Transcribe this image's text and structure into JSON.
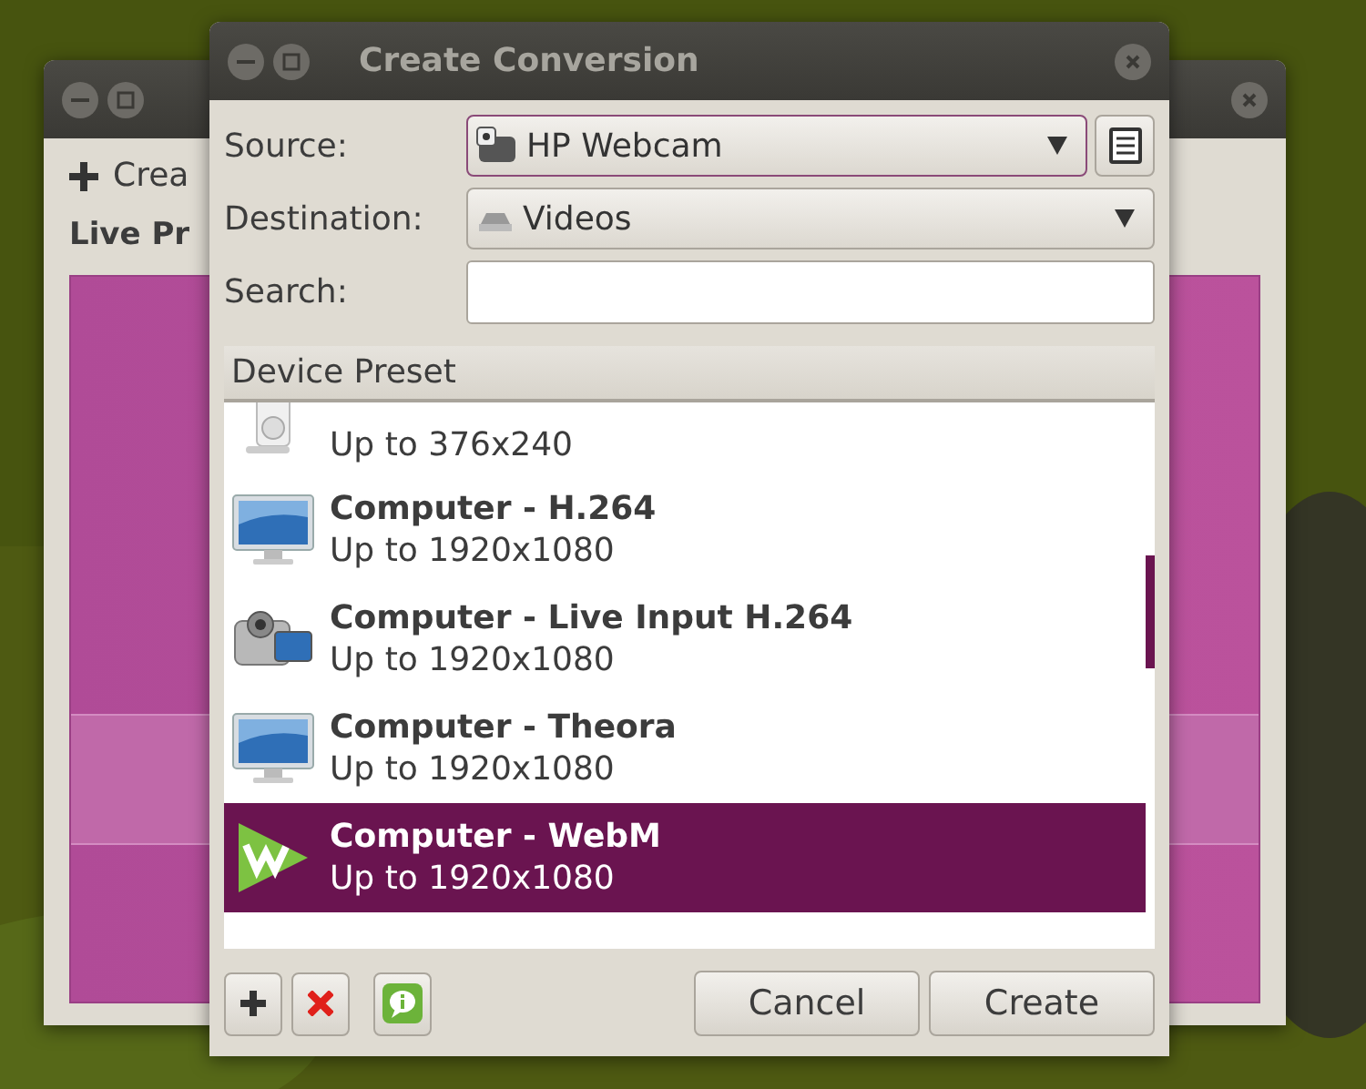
{
  "back_window": {
    "toolbar_label": "Crea",
    "section_title": "Live Pr"
  },
  "dialog": {
    "title": "Create Conversion",
    "source": {
      "label": "Source:",
      "value": "HP Webcam"
    },
    "destination": {
      "label": "Destination:",
      "value": "Videos"
    },
    "search": {
      "label": "Search:"
    },
    "list_header": "Device Preset",
    "presets": [
      {
        "subtitle": "Up to 376x240",
        "kind": "player",
        "selected": false
      },
      {
        "title": "Computer - H.264",
        "subtitle": "Up to 1920x1080",
        "kind": "monitor",
        "selected": false
      },
      {
        "title": "Computer - Live Input H.264",
        "subtitle": "Up to 1920x1080",
        "kind": "camcorder",
        "selected": false
      },
      {
        "title": "Computer - Theora",
        "subtitle": "Up to 1920x1080",
        "kind": "monitor",
        "selected": false
      },
      {
        "title": "Computer - WebM",
        "subtitle": "Up to 1920x1080",
        "kind": "webm",
        "selected": true
      }
    ],
    "tool_buttons": [
      {
        "kind": "add"
      },
      {
        "kind": "remove"
      },
      {
        "kind": "info"
      }
    ],
    "buttons": [
      "Cancel",
      "Create"
    ]
  }
}
